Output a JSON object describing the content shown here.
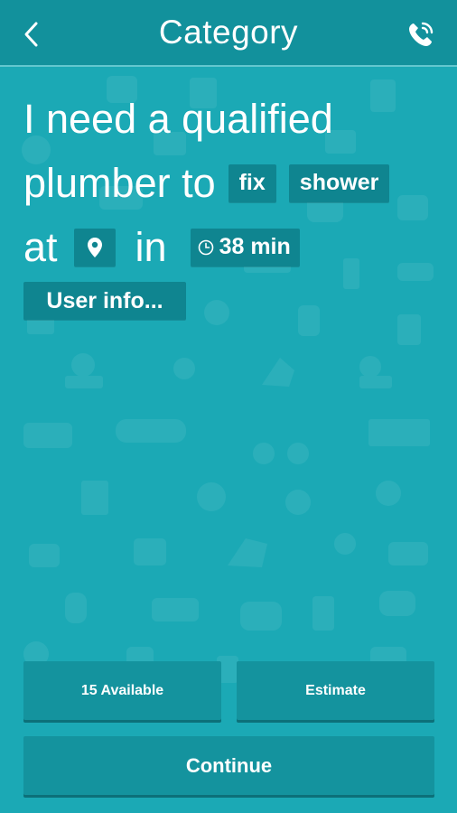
{
  "header": {
    "title": "Category",
    "back_icon": "chevron-left-icon",
    "call_icon": "phone-call-icon"
  },
  "request": {
    "line1": "I need a qualified",
    "line2_prefix": "plumber to",
    "action_chip": "fix",
    "object_chip": "shower",
    "line3_prefix": "at",
    "location_icon": "map-pin-icon",
    "line3_in": "in",
    "time_icon": "clock-icon",
    "time_chip": "38 min",
    "user_info": "User info..."
  },
  "actions": {
    "available_label": "15 Available",
    "estimate_label": "Estimate",
    "continue_label": "Continue"
  },
  "colors": {
    "background": "#1ba9b5",
    "header": "#12919c",
    "chip": "#0f8590",
    "button": "#14939e"
  }
}
